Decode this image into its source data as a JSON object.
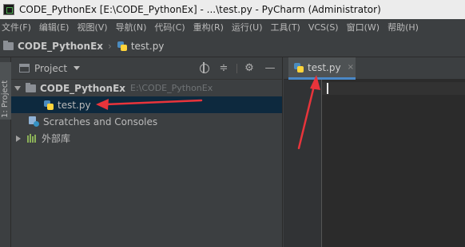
{
  "window": {
    "title": "CODE_PythonEx [E:\\CODE_PythonEx] - ...\\test.py - PyCharm (Administrator)"
  },
  "menu": {
    "items": [
      "文件(F)",
      "编辑(E)",
      "视图(V)",
      "导航(N)",
      "代码(C)",
      "重构(R)",
      "运行(U)",
      "工具(T)",
      "VCS(S)",
      "窗口(W)",
      "帮助(H)"
    ]
  },
  "navbar": {
    "project": "CODE_PythonEx",
    "file": "test.py"
  },
  "tool_strip": {
    "tab_label": "1: Project"
  },
  "project_panel": {
    "title": "Project",
    "tree": {
      "root_name": "CODE_PythonEx",
      "root_path": "E:\\CODE_PythonEx",
      "file_name": "test.py",
      "scratches": "Scratches and Consoles",
      "external_libs": "外部库"
    }
  },
  "editor": {
    "tab_label": "test.py",
    "tab_close": "×"
  },
  "icons": {
    "app": "pycharm-icon",
    "python_file": "python-file-icon",
    "folder": "folder-icon",
    "settings": "gear-icon",
    "locate": "target-icon",
    "collapse": "collapse-all-icon",
    "minimize": "minimize-icon"
  },
  "colors": {
    "annotation_arrow": "#e8343b",
    "tab_underline": "#4a88c7",
    "selection": "#0d293e"
  }
}
